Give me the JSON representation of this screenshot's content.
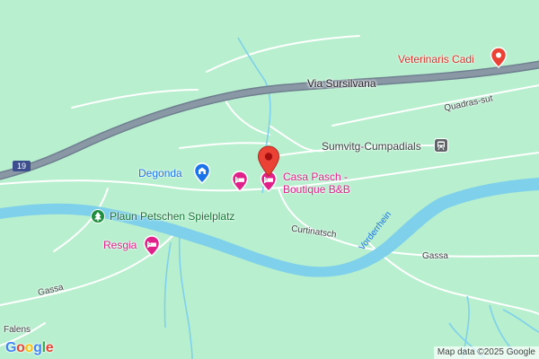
{
  "map": {
    "roads": {
      "via_sursilvana": "Via Sursilvana",
      "quadras_sut": "Quadras-sut",
      "curtinatsch": "Curtinatsch",
      "gassa_right": "Gassa",
      "gassa_left": "Gassa",
      "route_number": "19"
    },
    "rivers": {
      "vorderrhein": "Vorderrhein"
    },
    "places": {
      "falens": "Falens"
    },
    "pois": {
      "veterinaris": "Veterinaris Cadi",
      "degonda": "Degonda",
      "casa_pasch_line1": "Casa Pasch -",
      "casa_pasch_line2": "Boutique B&B",
      "sumvitg": "Sumvitg-Cumpadials",
      "plaun": "Plaun Petschen Spielplatz",
      "resgia": "Resgia"
    },
    "colors": {
      "land": "#b8f0cf",
      "water": "#7fd0ea",
      "highway": "#8a98a6",
      "hotel_pink": "#e0218a",
      "transit_blue": "#1a73e8",
      "park_green": "#137333",
      "pin_red": "#ea4335"
    },
    "icons": {
      "veterinaris": "pin-icon",
      "degonda": "lodging-icon",
      "casa_pasch": "bed-icon",
      "sumvitg": "train-station-icon",
      "plaun": "tree-icon",
      "resgia": "bed-icon",
      "selected": "location-pin-icon"
    }
  },
  "attribution": "Map data ©2025 Google",
  "logo": {
    "letters": [
      "G",
      "o",
      "o",
      "g",
      "l",
      "e"
    ]
  }
}
